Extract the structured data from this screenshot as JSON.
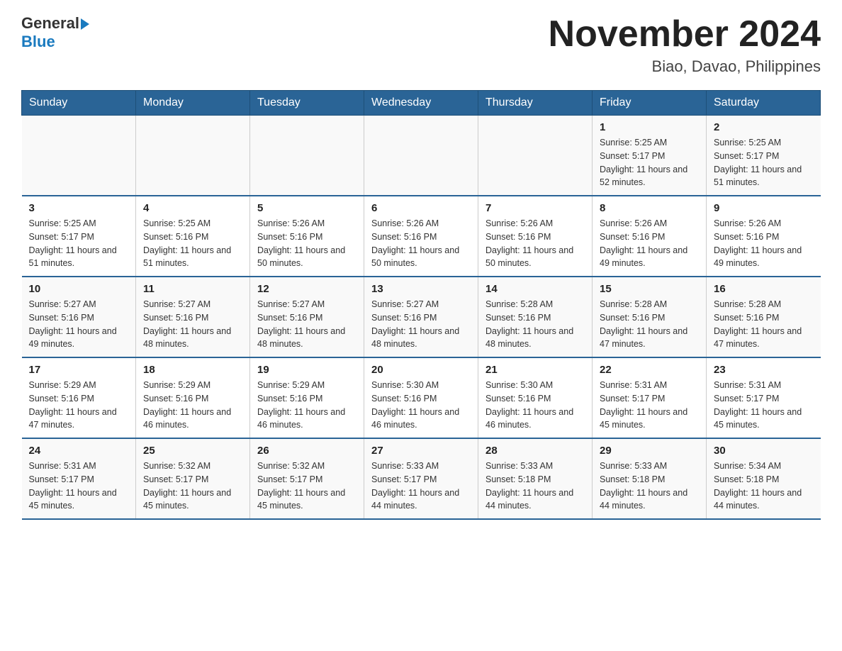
{
  "header": {
    "logo_general": "General",
    "logo_blue": "Blue",
    "main_title": "November 2024",
    "subtitle": "Biao, Davao, Philippines"
  },
  "days_of_week": [
    "Sunday",
    "Monday",
    "Tuesday",
    "Wednesday",
    "Thursday",
    "Friday",
    "Saturday"
  ],
  "weeks": [
    [
      {
        "day": "",
        "info": ""
      },
      {
        "day": "",
        "info": ""
      },
      {
        "day": "",
        "info": ""
      },
      {
        "day": "",
        "info": ""
      },
      {
        "day": "",
        "info": ""
      },
      {
        "day": "1",
        "info": "Sunrise: 5:25 AM\nSunset: 5:17 PM\nDaylight: 11 hours\nand 52 minutes."
      },
      {
        "day": "2",
        "info": "Sunrise: 5:25 AM\nSunset: 5:17 PM\nDaylight: 11 hours\nand 51 minutes."
      }
    ],
    [
      {
        "day": "3",
        "info": "Sunrise: 5:25 AM\nSunset: 5:17 PM\nDaylight: 11 hours\nand 51 minutes."
      },
      {
        "day": "4",
        "info": "Sunrise: 5:25 AM\nSunset: 5:16 PM\nDaylight: 11 hours\nand 51 minutes."
      },
      {
        "day": "5",
        "info": "Sunrise: 5:26 AM\nSunset: 5:16 PM\nDaylight: 11 hours\nand 50 minutes."
      },
      {
        "day": "6",
        "info": "Sunrise: 5:26 AM\nSunset: 5:16 PM\nDaylight: 11 hours\nand 50 minutes."
      },
      {
        "day": "7",
        "info": "Sunrise: 5:26 AM\nSunset: 5:16 PM\nDaylight: 11 hours\nand 50 minutes."
      },
      {
        "day": "8",
        "info": "Sunrise: 5:26 AM\nSunset: 5:16 PM\nDaylight: 11 hours\nand 49 minutes."
      },
      {
        "day": "9",
        "info": "Sunrise: 5:26 AM\nSunset: 5:16 PM\nDaylight: 11 hours\nand 49 minutes."
      }
    ],
    [
      {
        "day": "10",
        "info": "Sunrise: 5:27 AM\nSunset: 5:16 PM\nDaylight: 11 hours\nand 49 minutes."
      },
      {
        "day": "11",
        "info": "Sunrise: 5:27 AM\nSunset: 5:16 PM\nDaylight: 11 hours\nand 48 minutes."
      },
      {
        "day": "12",
        "info": "Sunrise: 5:27 AM\nSunset: 5:16 PM\nDaylight: 11 hours\nand 48 minutes."
      },
      {
        "day": "13",
        "info": "Sunrise: 5:27 AM\nSunset: 5:16 PM\nDaylight: 11 hours\nand 48 minutes."
      },
      {
        "day": "14",
        "info": "Sunrise: 5:28 AM\nSunset: 5:16 PM\nDaylight: 11 hours\nand 48 minutes."
      },
      {
        "day": "15",
        "info": "Sunrise: 5:28 AM\nSunset: 5:16 PM\nDaylight: 11 hours\nand 47 minutes."
      },
      {
        "day": "16",
        "info": "Sunrise: 5:28 AM\nSunset: 5:16 PM\nDaylight: 11 hours\nand 47 minutes."
      }
    ],
    [
      {
        "day": "17",
        "info": "Sunrise: 5:29 AM\nSunset: 5:16 PM\nDaylight: 11 hours\nand 47 minutes."
      },
      {
        "day": "18",
        "info": "Sunrise: 5:29 AM\nSunset: 5:16 PM\nDaylight: 11 hours\nand 46 minutes."
      },
      {
        "day": "19",
        "info": "Sunrise: 5:29 AM\nSunset: 5:16 PM\nDaylight: 11 hours\nand 46 minutes."
      },
      {
        "day": "20",
        "info": "Sunrise: 5:30 AM\nSunset: 5:16 PM\nDaylight: 11 hours\nand 46 minutes."
      },
      {
        "day": "21",
        "info": "Sunrise: 5:30 AM\nSunset: 5:16 PM\nDaylight: 11 hours\nand 46 minutes."
      },
      {
        "day": "22",
        "info": "Sunrise: 5:31 AM\nSunset: 5:17 PM\nDaylight: 11 hours\nand 45 minutes."
      },
      {
        "day": "23",
        "info": "Sunrise: 5:31 AM\nSunset: 5:17 PM\nDaylight: 11 hours\nand 45 minutes."
      }
    ],
    [
      {
        "day": "24",
        "info": "Sunrise: 5:31 AM\nSunset: 5:17 PM\nDaylight: 11 hours\nand 45 minutes."
      },
      {
        "day": "25",
        "info": "Sunrise: 5:32 AM\nSunset: 5:17 PM\nDaylight: 11 hours\nand 45 minutes."
      },
      {
        "day": "26",
        "info": "Sunrise: 5:32 AM\nSunset: 5:17 PM\nDaylight: 11 hours\nand 45 minutes."
      },
      {
        "day": "27",
        "info": "Sunrise: 5:33 AM\nSunset: 5:17 PM\nDaylight: 11 hours\nand 44 minutes."
      },
      {
        "day": "28",
        "info": "Sunrise: 5:33 AM\nSunset: 5:18 PM\nDaylight: 11 hours\nand 44 minutes."
      },
      {
        "day": "29",
        "info": "Sunrise: 5:33 AM\nSunset: 5:18 PM\nDaylight: 11 hours\nand 44 minutes."
      },
      {
        "day": "30",
        "info": "Sunrise: 5:34 AM\nSunset: 5:18 PM\nDaylight: 11 hours\nand 44 minutes."
      }
    ]
  ]
}
